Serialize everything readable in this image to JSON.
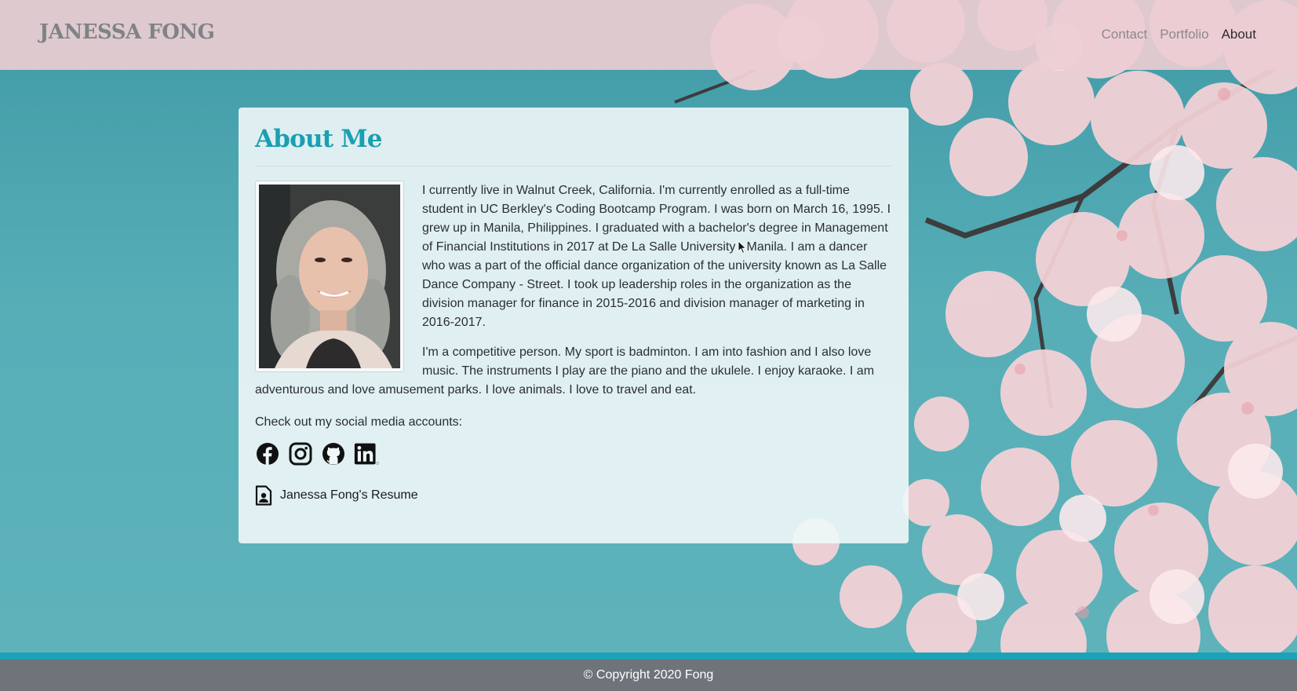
{
  "header": {
    "brand": "JANESSA FONG",
    "nav": [
      {
        "label": "Contact",
        "active": false
      },
      {
        "label": "Portfolio",
        "active": false
      },
      {
        "label": "About",
        "active": true
      }
    ]
  },
  "main": {
    "title": "About Me",
    "paragraph1": "I currently live in Walnut Creek, California. I'm currently enrolled as a full-time student in UC Berkley's Coding Bootcamp Program. I was born on March 16, 1995. I grew up in Manila, Philippines. I graduated with a bachelor's degree in Management of Financial Institutions in 2017 at De La Salle University - Manila. I am a dancer who was a part of the official dance organization of the university known as La Salle Dance Company - Street. I took up leadership roles in the organization as the division manager for finance in 2015-2016 and division manager of marketing in 2016-2017.",
    "paragraph2_part1": "I'm a competitive person. My sport is badminton. I am into fashion and I also love music. The instruments I play are the piano and the ukulele. I enjoy karaoke. I am",
    "paragraph2_part2": "adventurous and love amusement parks. I love animals. I love to travel and eat.",
    "social_heading": "Check out my social media accounts:",
    "social_icons": [
      "facebook-icon",
      "instagram-icon",
      "github-icon",
      "linkedin-icon"
    ],
    "resume_label": "Janessa Fong's Resume",
    "resume_icon": "file-person-icon"
  },
  "footer": {
    "copyright": "© Copyright 2020 Fong"
  },
  "colors": {
    "accent": "#19a0b2",
    "header_bg": "#eccdd2",
    "footer_bg": "#6f737a",
    "footer_stripe": "#1aa3b7",
    "page_bg": "#4ea3ad"
  }
}
